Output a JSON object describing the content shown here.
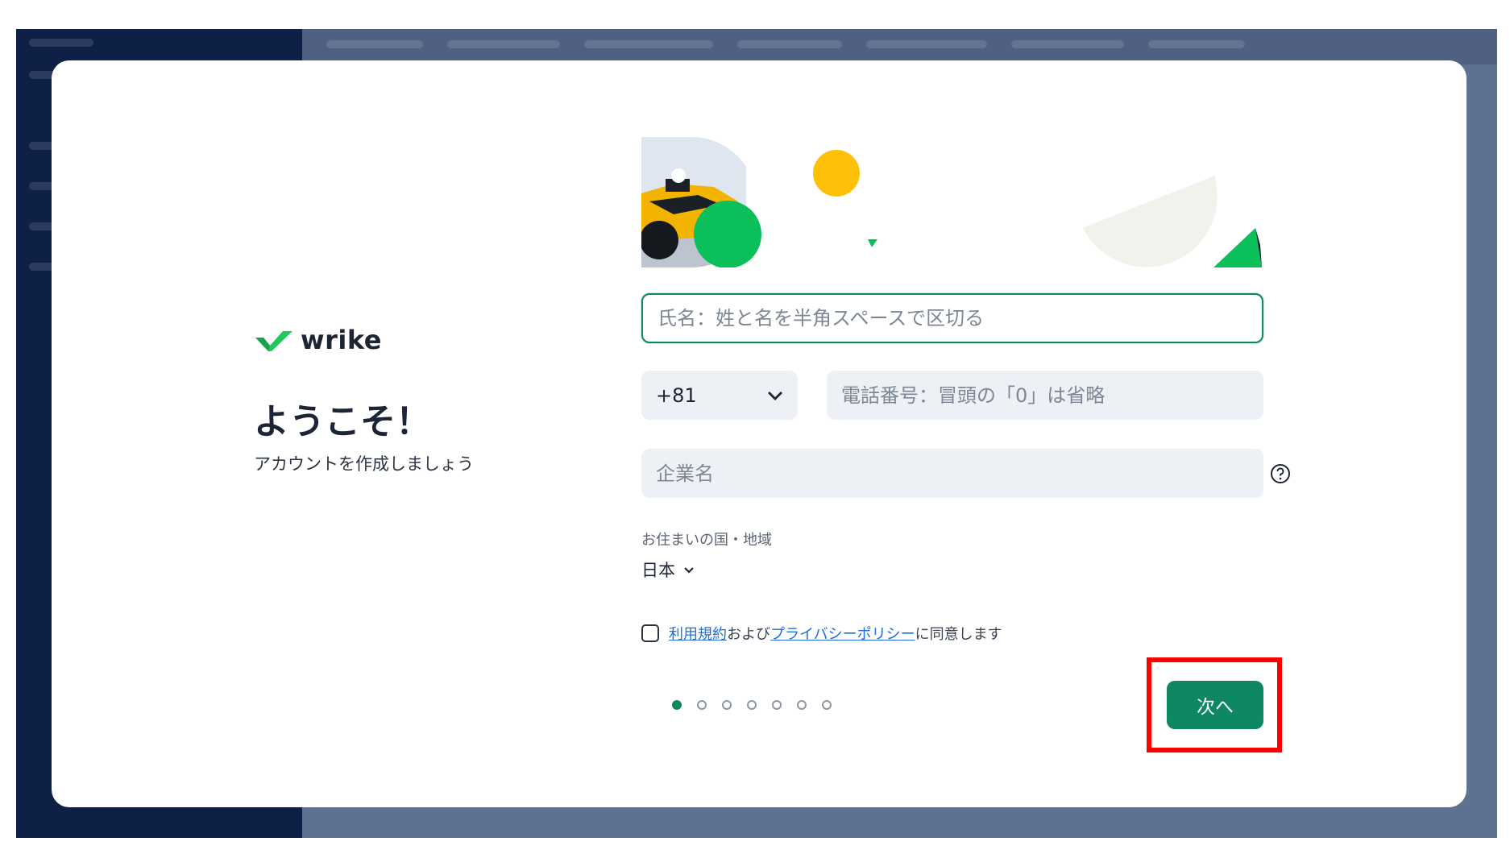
{
  "app_background": {
    "sidebar_color": "#0f2047",
    "content_color": "#5f7190"
  },
  "brand": {
    "logo_text": "wrike",
    "accent": "#0e8763",
    "logo_green": "#22c55e"
  },
  "intro": {
    "title": "ようこそ！",
    "subtitle": "アカウントを作成しましょう"
  },
  "form": {
    "name_placeholder": "氏名：姓と名を半角スペースで区切る",
    "phone_code": "+81",
    "phone_placeholder": "電話番号：冒頭の「0」は省略",
    "company_placeholder": "企業名",
    "region_label": "お住まいの国・地域",
    "region_value": "日本",
    "agree": {
      "terms_link": "利用規約",
      "conj": "および",
      "privacy_link": "プライバシーポリシー",
      "suffix": "に同意します"
    },
    "next_label": "次へ"
  },
  "progress": {
    "current_step": 1,
    "total_steps": 7
  },
  "annotation": {
    "highlight_color": "#ff0000",
    "target": "next-button"
  }
}
